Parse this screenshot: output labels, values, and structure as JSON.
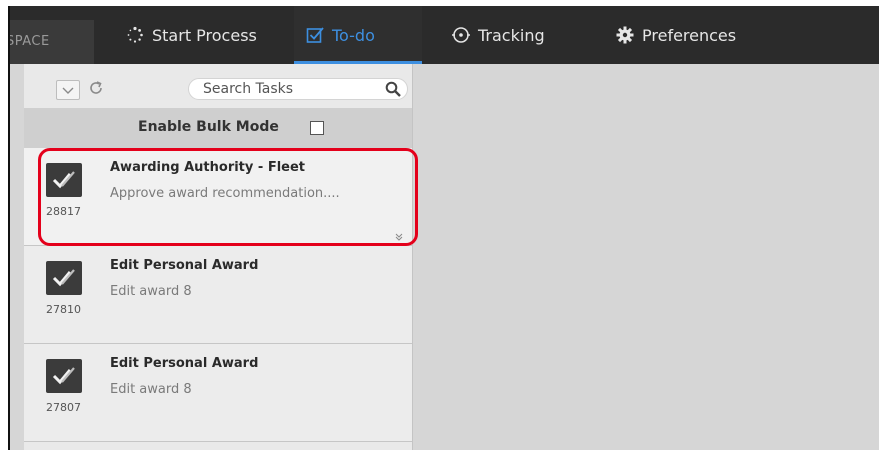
{
  "header": {
    "workspace_label": "SPACE",
    "tabs": [
      {
        "label": "Start Process",
        "icon": "spinner-icon",
        "active": false
      },
      {
        "label": "To-do",
        "icon": "checkbox-icon",
        "active": true
      },
      {
        "label": "Tracking",
        "icon": "target-icon",
        "active": false
      },
      {
        "label": "Preferences",
        "icon": "gear-icon",
        "active": false
      }
    ]
  },
  "panel": {
    "search": {
      "placeholder": "Search Tasks",
      "value": ""
    },
    "bulk_mode_label": "Enable Bulk Mode",
    "bulk_mode_checked": false,
    "tasks": [
      {
        "id": "28817",
        "title": "Awarding Authority - Fleet",
        "description": "Approve award recommendation....",
        "selected": true
      },
      {
        "id": "27810",
        "title": "Edit Personal Award",
        "description": "Edit award 8",
        "selected": false
      },
      {
        "id": "27807",
        "title": "Edit Personal Award",
        "description": "Edit award 8",
        "selected": false
      }
    ]
  },
  "colors": {
    "topbar": "#2b2b2b",
    "active_tab": "#3d8fe0",
    "highlight": "#e4001b",
    "content_bg": "#d6d6d6"
  }
}
